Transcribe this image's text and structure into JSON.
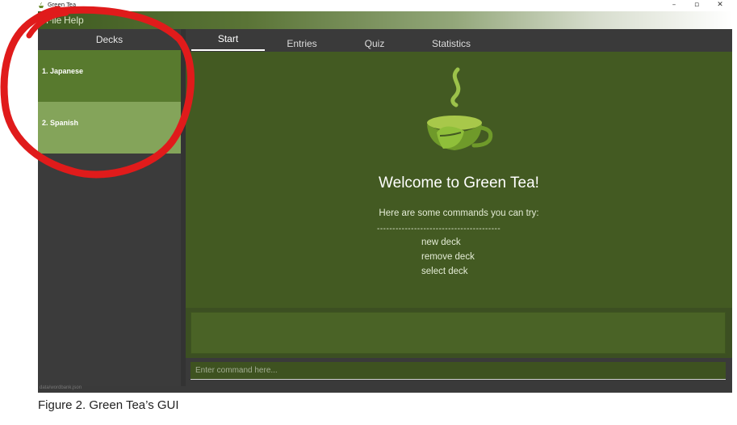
{
  "window": {
    "title": "Green Tea",
    "controls": {
      "minimize": "–",
      "maximize": "▫",
      "close": "✕"
    }
  },
  "menu": {
    "file": "File",
    "help": "Help"
  },
  "decks": {
    "header": "Decks",
    "items": [
      {
        "label": "1.  Japanese"
      },
      {
        "label": "2.  Spanish"
      }
    ]
  },
  "tabs": [
    {
      "label": "Start"
    },
    {
      "label": "Entries"
    },
    {
      "label": "Quiz"
    },
    {
      "label": "Statistics"
    }
  ],
  "start": {
    "welcome": "Welcome to Green Tea!",
    "hint": "Here are some commands you can try:",
    "divider": "----------------------------------------",
    "commands": [
      "new deck",
      "remove deck",
      "select deck"
    ]
  },
  "command_box": {
    "placeholder": "Enter command here..."
  },
  "status": {
    "path": "data/wordbank.json"
  },
  "caption": "Figure 2. Green Tea’s GUI",
  "colors": {
    "accent_green": "#587a2e",
    "selected_green": "#84a45a",
    "content_green": "#435a22",
    "annotation_red": "#e01b1b"
  }
}
